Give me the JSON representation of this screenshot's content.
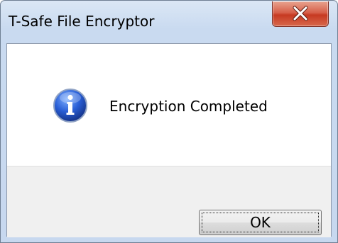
{
  "window": {
    "title": "T-Safe File Encryptor",
    "close_icon": "close-icon"
  },
  "dialog": {
    "icon": "info-icon",
    "message": "Encryption Completed",
    "ok_label": "OK"
  },
  "colors": {
    "frame": "#c7d8ef",
    "close_button": "#c73a22",
    "footer": "#f0f0f0"
  }
}
